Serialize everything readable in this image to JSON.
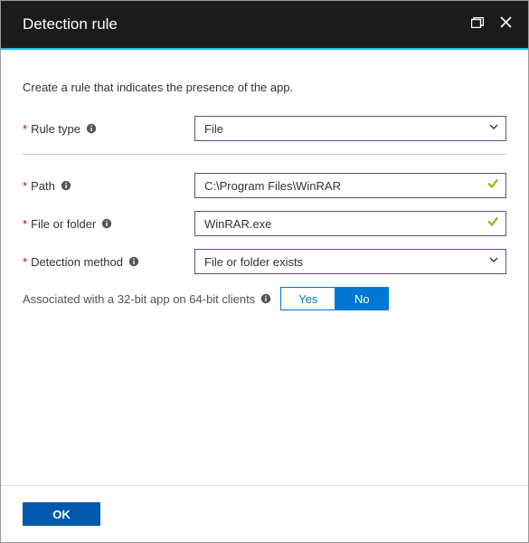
{
  "header": {
    "title": "Detection rule"
  },
  "subtitle": "Create a rule that indicates the presence of the app.",
  "fields": {
    "rule_type": {
      "label": "Rule type",
      "value": "File"
    },
    "path": {
      "label": "Path",
      "value": "C:\\Program Files\\WinRAR"
    },
    "file_or_folder": {
      "label": "File or folder",
      "value": "WinRAR.exe"
    },
    "detection_method": {
      "label": "Detection method",
      "value": "File or folder exists"
    }
  },
  "assoc": {
    "label": "Associated with a 32-bit app on 64-bit clients",
    "yes": "Yes",
    "no": "No",
    "selected": "No"
  },
  "footer": {
    "ok": "OK"
  }
}
